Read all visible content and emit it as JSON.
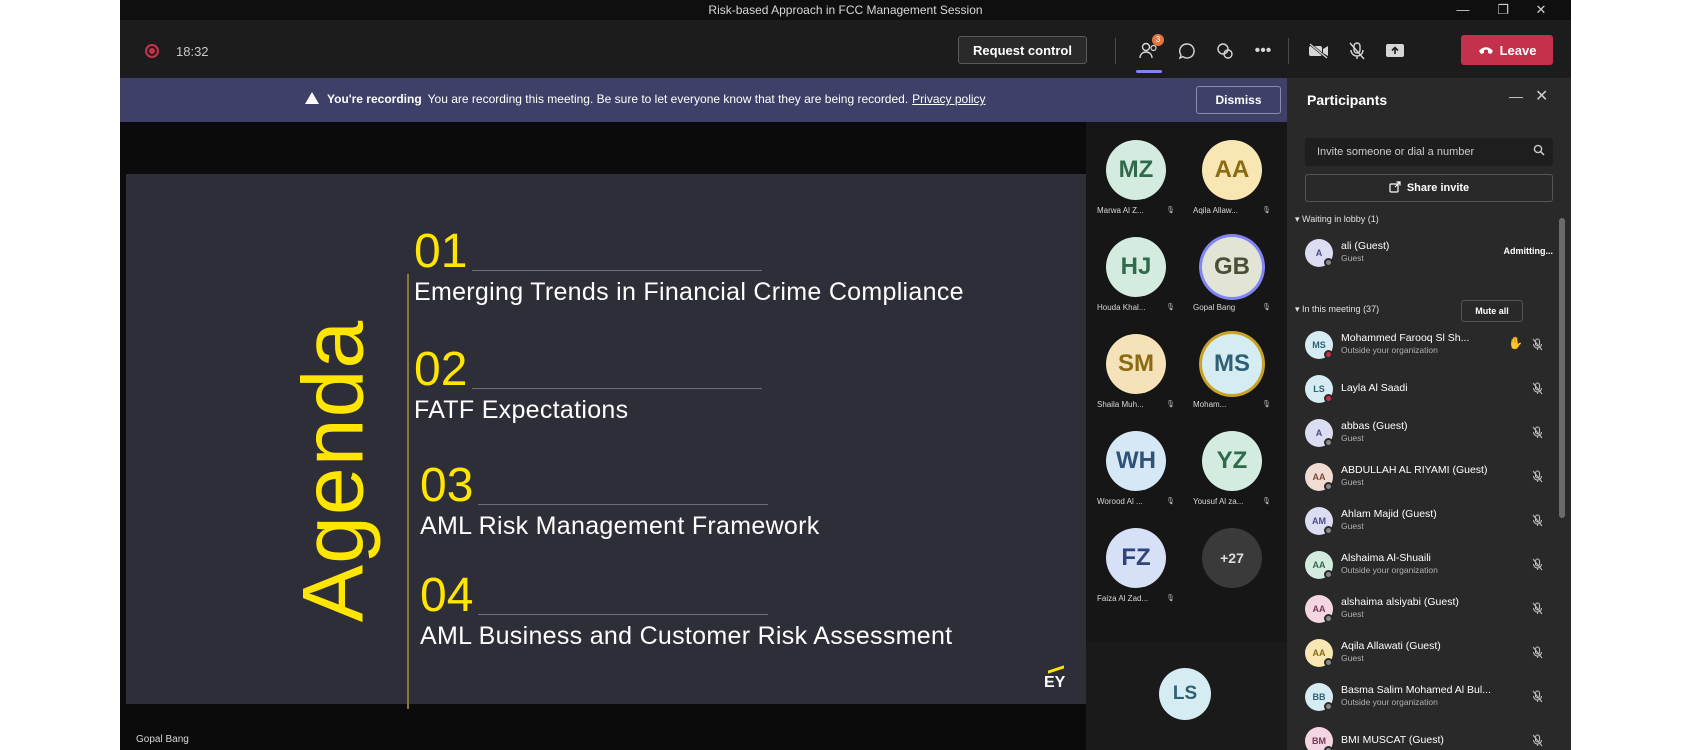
{
  "window": {
    "title": "Risk-based Approach in FCC Management Session",
    "controls": {
      "minimize": "—",
      "restore": "❐",
      "close": "✕"
    }
  },
  "toolbar": {
    "timer": "18:32",
    "request_control": "Request control",
    "participants_badge": "3",
    "leave": "Leave",
    "icons": [
      "people-icon",
      "chat-icon",
      "reactions-icon",
      "more-icon",
      "camera-off-icon",
      "mic-off-icon",
      "share-tray-icon",
      "phone-icon"
    ]
  },
  "banner": {
    "title": "You're recording",
    "message": "You are recording this meeting. Be sure to let everyone know that they are being recorded.",
    "link": "Privacy policy",
    "dismiss": "Dismiss"
  },
  "slide": {
    "heading": "Agenda",
    "items": [
      {
        "num": "01",
        "label": "Emerging Trends in Financial Crime Compliance"
      },
      {
        "num": "02",
        "label": "FATF Expectations"
      },
      {
        "num": "03",
        "label": "AML Risk Management Framework"
      },
      {
        "num": "04",
        "label": "AML Business and Customer Risk Assessment"
      }
    ],
    "logo": "EY",
    "presenter": "Gopal Bang"
  },
  "tiles": [
    {
      "initials": "MZ",
      "name": "Marwa Al Z...",
      "bg": "#d3ecdf",
      "fg": "#2f6a4a"
    },
    {
      "initials": "AA",
      "name": "Aqila Allaw...",
      "bg": "#f8e7b3",
      "fg": "#8a6a12"
    },
    {
      "initials": "HJ",
      "name": "Houda Khal...",
      "bg": "#d3ecdf",
      "fg": "#2f6a4a"
    },
    {
      "initials": "GB",
      "name": "Gopal Bang",
      "bg": "#e2e4d6",
      "fg": "#4c4f38"
    },
    {
      "initials": "SM",
      "name": "Shaila Muh...",
      "bg": "#f6e2b9",
      "fg": "#8a6a12"
    },
    {
      "initials": "MS",
      "name": "Moham...",
      "bg": "#d6ecf3",
      "fg": "#2f5f72"
    },
    {
      "initials": "WH",
      "name": "Worood Al ...",
      "bg": "#d6e7f6",
      "fg": "#2e5377"
    },
    {
      "initials": "YZ",
      "name": "Yousuf Al za...",
      "bg": "#d3ecdf",
      "fg": "#2f6a4a"
    },
    {
      "initials": "FZ",
      "name": "Faiza Al Zad...",
      "bg": "#d6e0f6",
      "fg": "#2e4577"
    },
    {
      "initials": "+27",
      "name": ""
    }
  ],
  "bottom_tile": {
    "initials": "LS"
  },
  "panel": {
    "title": "Participants",
    "invite_placeholder": "Invite someone or dial a number",
    "share_invite": "Share invite",
    "lobby_label": "Waiting in lobby (1)",
    "lobby": [
      {
        "initials": "A",
        "name": "ali (Guest)",
        "sub": "Guest",
        "action": "Admitting..."
      }
    ],
    "meeting_label": "In this meeting (37)",
    "mute_all": "Mute all",
    "people": [
      {
        "initials": "MS",
        "name": "Mohammed Farooq Sl Sh...",
        "sub": "Outside your organization",
        "bg": "#d6ecf3",
        "fg": "#2f5f72"
      },
      {
        "initials": "LS",
        "name": "Layla Al Saadi",
        "sub": "",
        "bg": "#d6ecf3",
        "fg": "#2f5f72"
      },
      {
        "initials": "A",
        "name": "abbas (Guest)",
        "sub": "Guest",
        "bg": "#dcdcf3",
        "fg": "#4a4a8a"
      },
      {
        "initials": "AA",
        "name": "ABDULLAH AL RIYAMI (Guest)",
        "sub": "Guest",
        "bg": "#f0dcd3",
        "fg": "#7a4a36"
      },
      {
        "initials": "AM",
        "name": "Ahlam Majid (Guest)",
        "sub": "Guest",
        "bg": "#dcdcf3",
        "fg": "#4a4a8a"
      },
      {
        "initials": "AA",
        "name": "Alshaima Al-Shuaili",
        "sub": "Outside your organization",
        "bg": "#d3ecdf",
        "fg": "#2f6a4a"
      },
      {
        "initials": "AA",
        "name": "alshaima alsiyabi (Guest)",
        "sub": "Guest",
        "bg": "#f3d6e2",
        "fg": "#7a3651"
      },
      {
        "initials": "AA",
        "name": "Aqila Allawati (Guest)",
        "sub": "Guest",
        "bg": "#f8e7b3",
        "fg": "#8a6a12"
      },
      {
        "initials": "BB",
        "name": "Basma Salim Mohamed Al Bul...",
        "sub": "Outside your organization",
        "bg": "#d6ecf3",
        "fg": "#2f5f72"
      },
      {
        "initials": "BM",
        "name": "BMI MUSCAT (Guest)",
        "sub": "",
        "bg": "#f3d6e2",
        "fg": "#7a3651"
      }
    ]
  }
}
